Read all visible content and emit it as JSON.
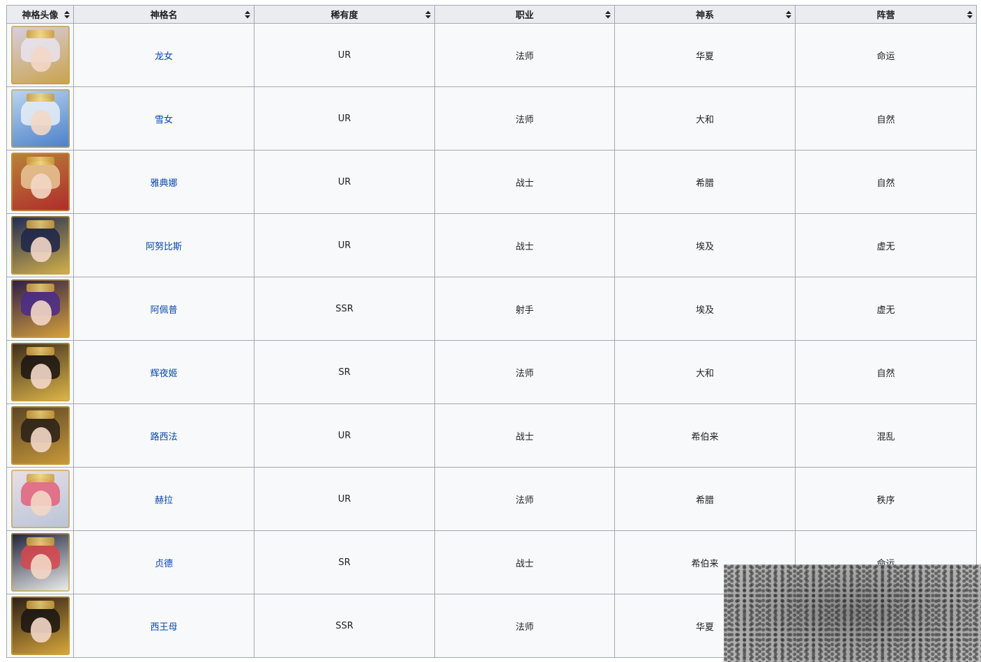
{
  "table": {
    "headers": [
      "神格头像",
      "神格名",
      "稀有度",
      "职业",
      "神系",
      "阵营"
    ],
    "rows": [
      {
        "name": "龙女",
        "rarity": "UR",
        "class": "法师",
        "pantheon": "华夏",
        "faction": "命运",
        "avatar_colors": {
          "bg": "#d8cfe2",
          "hair": "#e9e4ef",
          "accent": "#c9a24a"
        }
      },
      {
        "name": "雪女",
        "rarity": "UR",
        "class": "法师",
        "pantheon": "大和",
        "faction": "自然",
        "avatar_colors": {
          "bg": "#bcd6ef",
          "hair": "#e7eef7",
          "accent": "#4a7fc9"
        }
      },
      {
        "name": "雅典娜",
        "rarity": "UR",
        "class": "战士",
        "pantheon": "希腊",
        "faction": "自然",
        "avatar_colors": {
          "bg": "#b8843a",
          "hair": "#e9c796",
          "accent": "#b02a2a"
        }
      },
      {
        "name": "阿努比斯",
        "rarity": "UR",
        "class": "战士",
        "pantheon": "埃及",
        "faction": "虚无",
        "avatar_colors": {
          "bg": "#1c2a55",
          "hair": "#1d2448",
          "accent": "#d7b24a"
        }
      },
      {
        "name": "阿佩普",
        "rarity": "SSR",
        "class": "射手",
        "pantheon": "埃及",
        "faction": "虚无",
        "avatar_colors": {
          "bg": "#2a1c4a",
          "hair": "#4b2a8a",
          "accent": "#d9a33a"
        }
      },
      {
        "name": "辉夜姬",
        "rarity": "SR",
        "class": "法师",
        "pantheon": "大和",
        "faction": "自然",
        "avatar_colors": {
          "bg": "#3a2a1c",
          "hair": "#1a1410",
          "accent": "#e0b84a"
        }
      },
      {
        "name": "路西法",
        "rarity": "UR",
        "class": "战士",
        "pantheon": "希伯来",
        "faction": "混乱",
        "avatar_colors": {
          "bg": "#5a4426",
          "hair": "#2a2018",
          "accent": "#c99a3a"
        }
      },
      {
        "name": "赫拉",
        "rarity": "UR",
        "class": "法师",
        "pantheon": "希腊",
        "faction": "秩序",
        "avatar_colors": {
          "bg": "#e9dfe6",
          "hair": "#e2607a",
          "accent": "#b8c4d6"
        }
      },
      {
        "name": "贞德",
        "rarity": "SR",
        "class": "战士",
        "pantheon": "希伯来",
        "faction": "命运",
        "avatar_colors": {
          "bg": "#1c2138",
          "hair": "#d9464e",
          "accent": "#f0f0f0"
        }
      },
      {
        "name": "西王母",
        "rarity": "SSR",
        "class": "法师",
        "pantheon": "华夏",
        "faction": "",
        "avatar_colors": {
          "bg": "#2a1c18",
          "hair": "#1a1412",
          "accent": "#d9a93a"
        }
      }
    ]
  }
}
